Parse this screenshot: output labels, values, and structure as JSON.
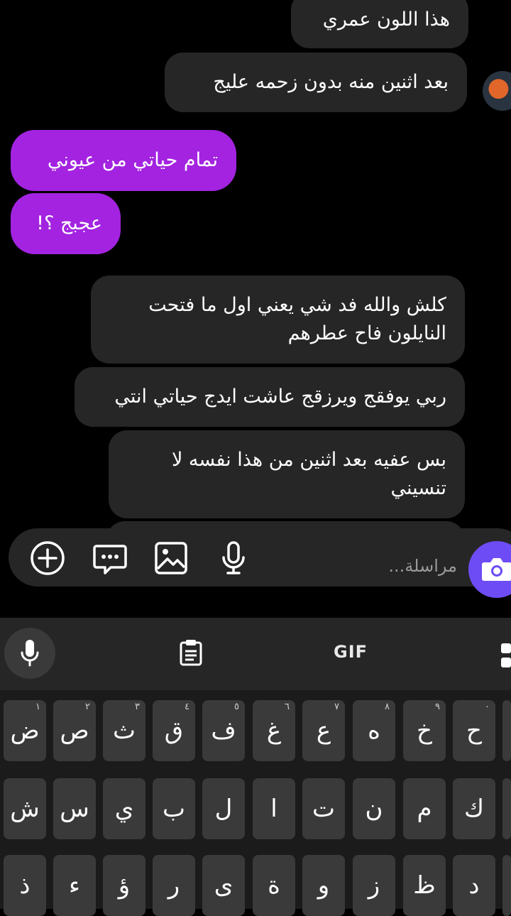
{
  "messages": [
    {
      "text": "هذا اللون عمري",
      "type": "received"
    },
    {
      "text": "بعد اثنين منه بدون زحمه عليج",
      "type": "received"
    },
    {
      "text": "تمام حياتي من عيوني",
      "type": "sent"
    },
    {
      "text": "عجبج ؟!",
      "type": "sent"
    },
    {
      "lines": [
        "كلش والله فد شي يعني اول ما فتحت",
        "النايلون فاح عطرهم"
      ],
      "type": "received"
    },
    {
      "text": "ربي يوفقج ويرزقج عاشت ايدج حياتي انتي",
      "type": "received"
    },
    {
      "lines": [
        "بس عفيه بعد اثنين من هذا نفسه لا",
        "تنسيني"
      ],
      "type": "received"
    }
  ],
  "composer": {
    "placeholder": "مراسلة...",
    "icons": [
      "add-icon",
      "sticker-icon",
      "gallery-icon",
      "microphone-icon",
      "camera-icon"
    ]
  },
  "keyboard": {
    "gif_label": "GIF",
    "row1": [
      {
        "char": "ض",
        "hint": "١"
      },
      {
        "char": "ص",
        "hint": "٢"
      },
      {
        "char": "ث",
        "hint": "٣"
      },
      {
        "char": "ق",
        "hint": "٤"
      },
      {
        "char": "ف",
        "hint": "٥"
      },
      {
        "char": "غ",
        "hint": "٦"
      },
      {
        "char": "ع",
        "hint": "٧"
      },
      {
        "char": "ه",
        "hint": "٨"
      },
      {
        "char": "خ",
        "hint": "٩"
      },
      {
        "char": "ح",
        "hint": "٠"
      }
    ],
    "row2": [
      "ش",
      "س",
      "ي",
      "ب",
      "ل",
      "ا",
      "ت",
      "ن",
      "م",
      "ك"
    ],
    "row3": [
      "ذ",
      "ء",
      "ؤ",
      "ر",
      "ى",
      "ة",
      "و",
      "ز",
      "ظ",
      "د"
    ]
  }
}
